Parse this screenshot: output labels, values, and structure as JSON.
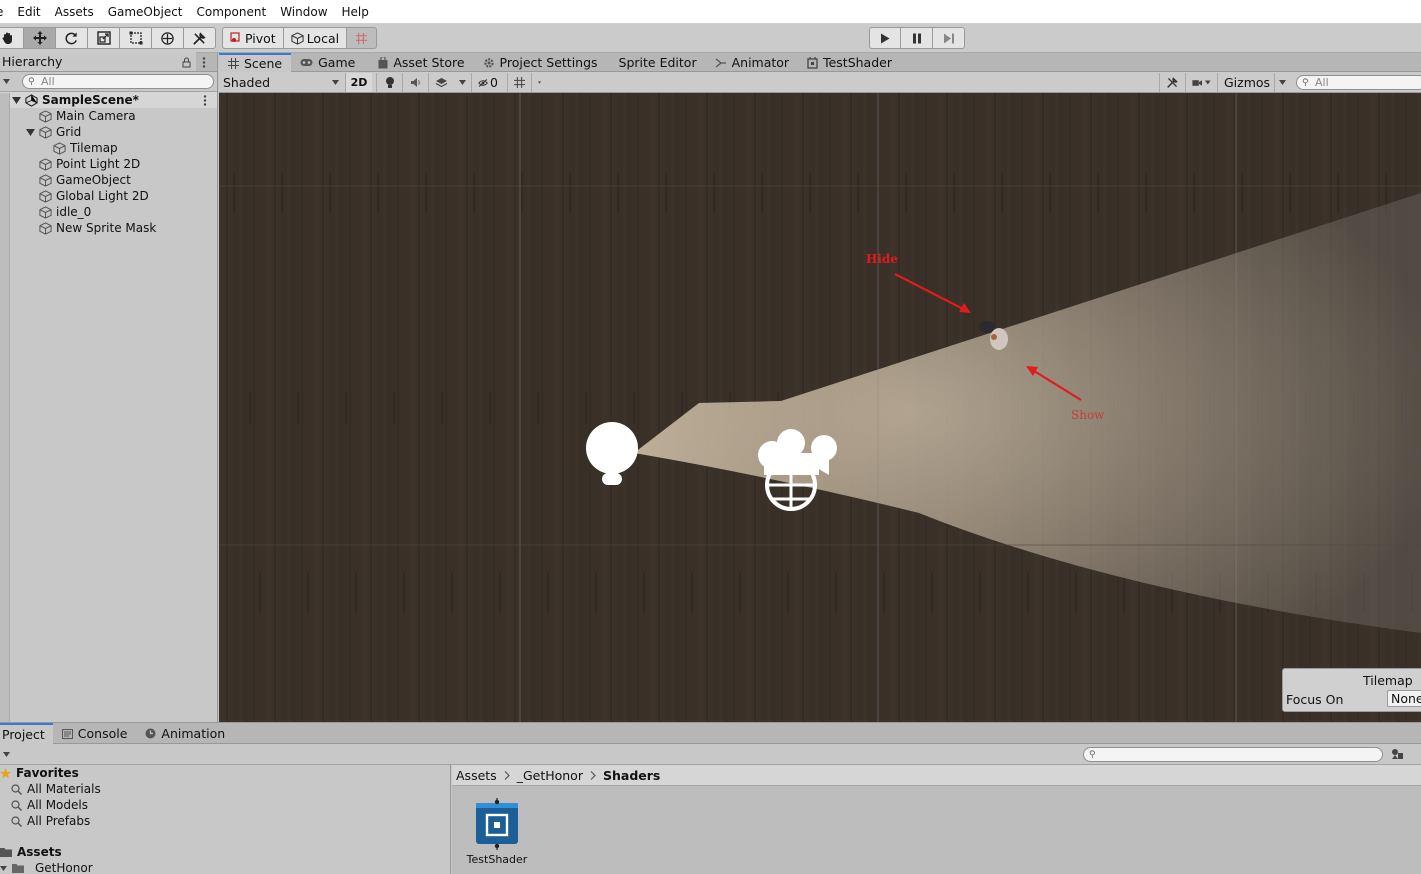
{
  "menu": [
    "e",
    "Edit",
    "Assets",
    "GameObject",
    "Component",
    "Window",
    "Help"
  ],
  "toolbar": {
    "pivot_label": "Pivot",
    "local_label": "Local"
  },
  "hierarchy": {
    "tab_label": "Hierarchy",
    "search_placeholder": "All",
    "scene_name": "SampleScene*",
    "items": [
      {
        "label": "Main Camera"
      },
      {
        "label": "Grid"
      },
      {
        "label": "Tilemap"
      },
      {
        "label": "Point Light 2D"
      },
      {
        "label": "GameObject"
      },
      {
        "label": "Global Light 2D"
      },
      {
        "label": "idle_0"
      },
      {
        "label": "New Sprite Mask"
      }
    ]
  },
  "scene_tabs": [
    {
      "label": "Scene",
      "icon": "grid-icon"
    },
    {
      "label": "Game",
      "icon": "gamepad-icon"
    },
    {
      "label": "Asset Store",
      "icon": "bag-icon"
    },
    {
      "label": "Project Settings",
      "icon": "gear-icon"
    },
    {
      "label": "Sprite Editor",
      "icon": ""
    },
    {
      "label": "Animator",
      "icon": "animator-icon"
    },
    {
      "label": "TestShader",
      "icon": "shader-graph-icon"
    }
  ],
  "scene_toolbar": {
    "shading_mode": "Shaded",
    "mode_2d": "2D",
    "hidden_count": "0",
    "gizmos_label": "Gizmos",
    "search_placeholder": "All"
  },
  "annotations": {
    "hide_label": "Hide",
    "show_label": "Show",
    "color": "#e01c1c"
  },
  "tilemap_overlay": {
    "title": "Tilemap",
    "focus_label": "Focus On",
    "focus_value": "None"
  },
  "bottom_tabs": [
    {
      "label": "Project",
      "icon": ""
    },
    {
      "label": "Console",
      "icon": "console-icon"
    },
    {
      "label": "Animation",
      "icon": "animation-icon"
    }
  ],
  "favorites": {
    "title": "Favorites",
    "items": [
      "All Materials",
      "All Models",
      "All Prefabs"
    ]
  },
  "assets_tree": {
    "root": "Assets",
    "child": "_GetHonor"
  },
  "breadcrumb": [
    "Assets",
    "_GetHonor",
    "Shaders"
  ],
  "asset_item": {
    "label": "TestShader"
  },
  "colors": {
    "accent": "#3a79d0",
    "panel": "#c8c8c8",
    "scene_bg": "#3b322a"
  }
}
